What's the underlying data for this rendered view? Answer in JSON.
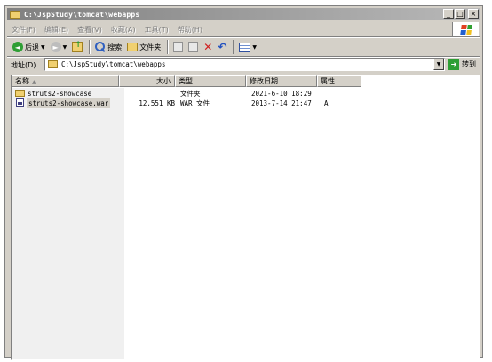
{
  "window": {
    "title": "C:\\JspStudy\\tomcat\\webapps",
    "minimize_label": "_",
    "maximize_label": "□",
    "close_label": "×"
  },
  "menu": {
    "items": [
      "文件(F)",
      "编辑(E)",
      "查看(V)",
      "收藏(A)",
      "工具(T)",
      "帮助(H)"
    ]
  },
  "toolbar": {
    "back_label": "后退",
    "search_label": "搜索",
    "folders_label": "文件夹"
  },
  "address": {
    "label": "地址(D)",
    "value": "C:\\JspStudy\\tomcat\\webapps",
    "go_label": "转到"
  },
  "list": {
    "columns": {
      "name": "名称",
      "size": "大小",
      "type": "类型",
      "modified": "修改日期",
      "attributes": "属性"
    },
    "rows": [
      {
        "name": "struts2-showcase",
        "size": "",
        "type": "文件夹",
        "modified": "2021-6-10 18:29",
        "attributes": "",
        "icon": "folder-icon"
      },
      {
        "name": "struts2-showcase.war",
        "size": "12,551 KB",
        "type": "WAR 文件",
        "modified": "2013-7-14 21:47",
        "attributes": "A",
        "icon": "war-file-icon"
      }
    ]
  },
  "colors": {
    "title_gradient_start": "#808080",
    "window_face": "#d4d0c8",
    "folder_yellow": "#f0d070"
  }
}
